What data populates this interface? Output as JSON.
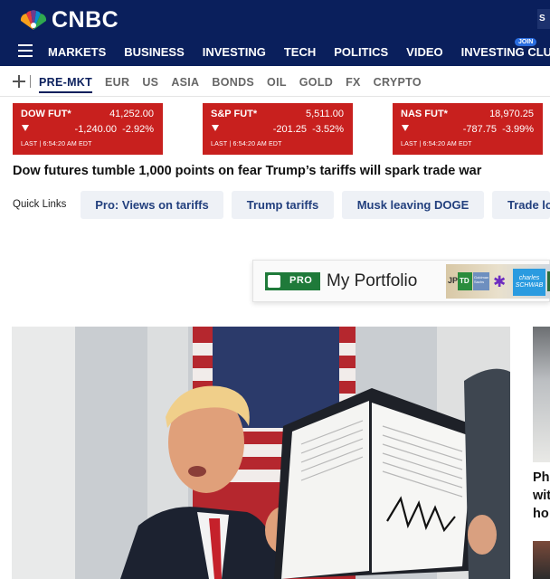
{
  "header": {
    "logo_text": "CNBC",
    "signin_fragment": "S",
    "nav": [
      "MARKETS",
      "BUSINESS",
      "INVESTING",
      "TECH",
      "POLITICS",
      "VIDEO",
      "INVESTING CLUB"
    ],
    "join_badge": "JOIN",
    "colors": {
      "navy": "#0a1f5c",
      "join": "#2a6de0"
    }
  },
  "market_tabs": {
    "items": [
      "PRE-MKT",
      "EUR",
      "US",
      "ASIA",
      "BONDS",
      "OIL",
      "GOLD",
      "FX",
      "CRYPTO"
    ],
    "active": "PRE-MKT"
  },
  "quotes": [
    {
      "name": "DOW FUT*",
      "price": "41,252.00",
      "change": "-1,240.00",
      "percent": "-2.92%",
      "last": "LAST | 6:54:20 AM EDT"
    },
    {
      "name": "S&P FUT*",
      "price": "5,511.00",
      "change": "-201.25",
      "percent": "-3.52%",
      "last": "LAST | 6:54:20 AM EDT"
    },
    {
      "name": "NAS FUT*",
      "price": "18,970.25",
      "change": "-787.75",
      "percent": "-3.99%",
      "last": "LAST | 6:54:20 AM EDT"
    }
  ],
  "quote_color": "#c8201e",
  "headline": "Dow futures tumble 1,000 points on fear Trump’s tariffs will spark trade war",
  "quick_links": {
    "label": "Quick Links",
    "items": [
      "Pro: Views on tariffs",
      "Trump tariffs",
      "Musk leaving DOGE",
      "Trade lo"
    ]
  },
  "pro_banner": {
    "badge": "PRO",
    "title": "My Portfolio",
    "brands": [
      "JP",
      "TD",
      "Goldman Sachs",
      "charles SCHWAB"
    ]
  },
  "side_story": {
    "headline_lines": [
      "Ph",
      "wit",
      "ho"
    ]
  }
}
